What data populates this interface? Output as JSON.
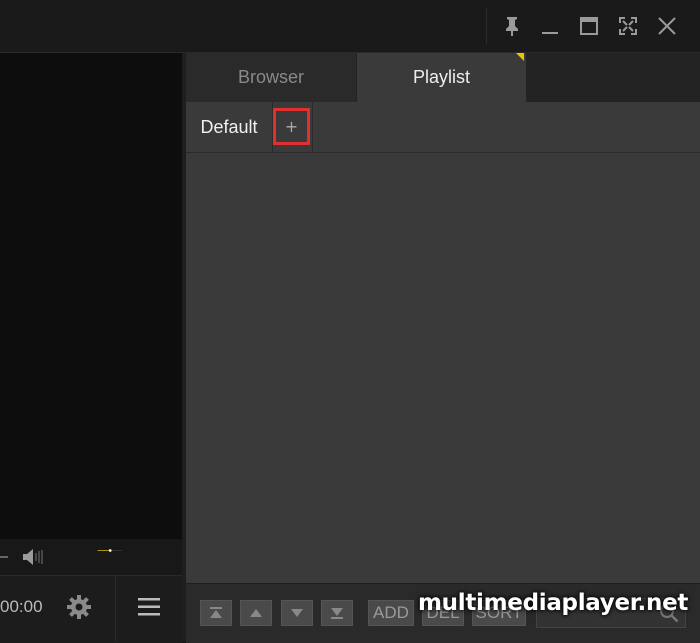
{
  "titlebar": {
    "buttons": [
      {
        "name": "pin-icon"
      },
      {
        "name": "minimize-icon"
      },
      {
        "name": "maximize-icon"
      },
      {
        "name": "fullscreen-icon"
      },
      {
        "name": "close-icon"
      }
    ]
  },
  "player": {
    "time": "00:00",
    "volume_fraction": 0.52,
    "accent": "#f0c800"
  },
  "panel": {
    "tabs": [
      {
        "label": "Browser",
        "active": false
      },
      {
        "label": "Playlist",
        "active": true
      }
    ],
    "playlist_tabs": [
      {
        "label": "Default"
      }
    ],
    "add_tab_label": "+",
    "highlight_color": "#e03030"
  },
  "bottombar": {
    "nav": [
      {
        "name": "move-top-icon"
      },
      {
        "name": "move-up-icon"
      },
      {
        "name": "move-down-icon"
      },
      {
        "name": "move-bottom-icon"
      }
    ],
    "add_label": "ADD",
    "del_label": "DEL",
    "sort_label": "SORT",
    "search_placeholder": ""
  },
  "watermark": "multimediaplayer.net"
}
